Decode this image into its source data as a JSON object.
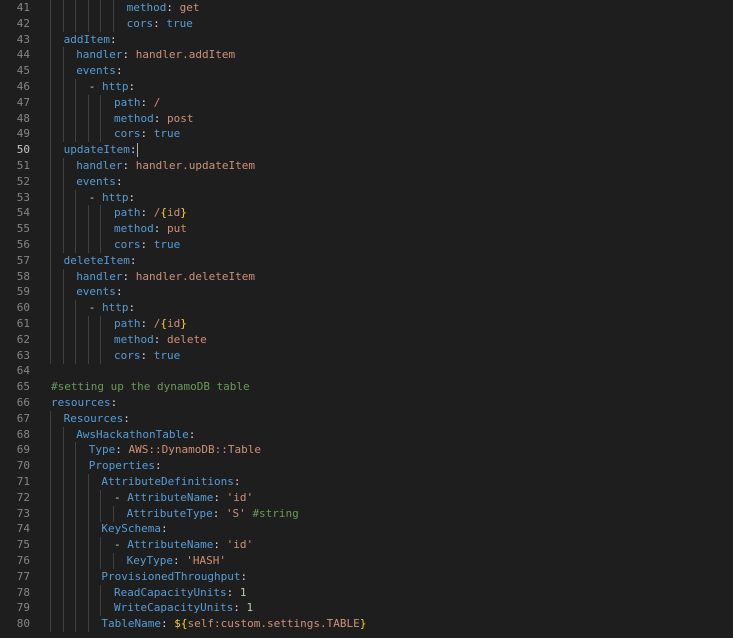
{
  "editor": {
    "active_line": 50,
    "lines": [
      {
        "no": "41",
        "indent": 6,
        "segs": [
          {
            "t": "method",
            "c": "k"
          },
          {
            "t": ": ",
            "c": "p"
          },
          {
            "t": "get",
            "c": "s"
          }
        ]
      },
      {
        "no": "42",
        "indent": 6,
        "segs": [
          {
            "t": "cors",
            "c": "k"
          },
          {
            "t": ": ",
            "c": "p"
          },
          {
            "t": "true",
            "c": "k"
          }
        ]
      },
      {
        "no": "43",
        "indent": 1,
        "segs": [
          {
            "t": "addItem",
            "c": "k"
          },
          {
            "t": ":",
            "c": "p"
          }
        ]
      },
      {
        "no": "44",
        "indent": 2,
        "segs": [
          {
            "t": "handler",
            "c": "k"
          },
          {
            "t": ": ",
            "c": "p"
          },
          {
            "t": "handler.addItem",
            "c": "s"
          }
        ]
      },
      {
        "no": "45",
        "indent": 2,
        "segs": [
          {
            "t": "events",
            "c": "k"
          },
          {
            "t": ":",
            "c": "p"
          }
        ]
      },
      {
        "no": "46",
        "indent": 3,
        "segs": [
          {
            "t": "- ",
            "c": "p"
          },
          {
            "t": "http",
            "c": "k"
          },
          {
            "t": ":",
            "c": "p"
          }
        ]
      },
      {
        "no": "47",
        "indent": 5,
        "segs": [
          {
            "t": "path",
            "c": "k"
          },
          {
            "t": ": ",
            "c": "p"
          },
          {
            "t": "/",
            "c": "s"
          }
        ]
      },
      {
        "no": "48",
        "indent": 5,
        "segs": [
          {
            "t": "method",
            "c": "k"
          },
          {
            "t": ": ",
            "c": "p"
          },
          {
            "t": "post",
            "c": "s"
          }
        ]
      },
      {
        "no": "49",
        "indent": 5,
        "segs": [
          {
            "t": "cors",
            "c": "k"
          },
          {
            "t": ": ",
            "c": "p"
          },
          {
            "t": "true",
            "c": "k"
          }
        ]
      },
      {
        "no": "50",
        "indent": 1,
        "segs": [
          {
            "t": "updateItem",
            "c": "k"
          },
          {
            "t": ":",
            "c": "p"
          }
        ]
      },
      {
        "no": "51",
        "indent": 2,
        "segs": [
          {
            "t": "handler",
            "c": "k"
          },
          {
            "t": ": ",
            "c": "p"
          },
          {
            "t": "handler.updateItem",
            "c": "s"
          }
        ]
      },
      {
        "no": "52",
        "indent": 2,
        "segs": [
          {
            "t": "events",
            "c": "k"
          },
          {
            "t": ":",
            "c": "p"
          }
        ]
      },
      {
        "no": "53",
        "indent": 3,
        "segs": [
          {
            "t": "- ",
            "c": "p"
          },
          {
            "t": "http",
            "c": "k"
          },
          {
            "t": ":",
            "c": "p"
          }
        ]
      },
      {
        "no": "54",
        "indent": 5,
        "segs": [
          {
            "t": "path",
            "c": "k"
          },
          {
            "t": ": ",
            "c": "p"
          },
          {
            "t": "/",
            "c": "s"
          },
          {
            "t": "{",
            "c": "b"
          },
          {
            "t": "id",
            "c": "s"
          },
          {
            "t": "}",
            "c": "b"
          }
        ]
      },
      {
        "no": "55",
        "indent": 5,
        "segs": [
          {
            "t": "method",
            "c": "k"
          },
          {
            "t": ": ",
            "c": "p"
          },
          {
            "t": "put",
            "c": "s"
          }
        ]
      },
      {
        "no": "56",
        "indent": 5,
        "segs": [
          {
            "t": "cors",
            "c": "k"
          },
          {
            "t": ": ",
            "c": "p"
          },
          {
            "t": "true",
            "c": "k"
          }
        ]
      },
      {
        "no": "57",
        "indent": 1,
        "segs": [
          {
            "t": "deleteItem",
            "c": "k"
          },
          {
            "t": ":",
            "c": "p"
          }
        ]
      },
      {
        "no": "58",
        "indent": 2,
        "segs": [
          {
            "t": "handler",
            "c": "k"
          },
          {
            "t": ": ",
            "c": "p"
          },
          {
            "t": "handler.deleteItem",
            "c": "s"
          }
        ]
      },
      {
        "no": "59",
        "indent": 2,
        "segs": [
          {
            "t": "events",
            "c": "k"
          },
          {
            "t": ":",
            "c": "p"
          }
        ]
      },
      {
        "no": "60",
        "indent": 3,
        "segs": [
          {
            "t": "- ",
            "c": "p"
          },
          {
            "t": "http",
            "c": "k"
          },
          {
            "t": ":",
            "c": "p"
          }
        ]
      },
      {
        "no": "61",
        "indent": 5,
        "segs": [
          {
            "t": "path",
            "c": "k"
          },
          {
            "t": ": ",
            "c": "p"
          },
          {
            "t": "/",
            "c": "s"
          },
          {
            "t": "{",
            "c": "b"
          },
          {
            "t": "id",
            "c": "s"
          },
          {
            "t": "}",
            "c": "b"
          }
        ]
      },
      {
        "no": "62",
        "indent": 5,
        "segs": [
          {
            "t": "method",
            "c": "k"
          },
          {
            "t": ": ",
            "c": "p"
          },
          {
            "t": "delete",
            "c": "s"
          }
        ]
      },
      {
        "no": "63",
        "indent": 5,
        "segs": [
          {
            "t": "cors",
            "c": "k"
          },
          {
            "t": ": ",
            "c": "p"
          },
          {
            "t": "true",
            "c": "k"
          }
        ]
      },
      {
        "no": "64",
        "indent": 0,
        "segs": []
      },
      {
        "no": "65",
        "indent": 0,
        "segs": [
          {
            "t": "#setting up the dynamoDB table",
            "c": "c"
          }
        ]
      },
      {
        "no": "66",
        "indent": 0,
        "segs": [
          {
            "t": "resources",
            "c": "k"
          },
          {
            "t": ":",
            "c": "p"
          }
        ]
      },
      {
        "no": "67",
        "indent": 1,
        "segs": [
          {
            "t": "Resources",
            "c": "k"
          },
          {
            "t": ":",
            "c": "p"
          }
        ]
      },
      {
        "no": "68",
        "indent": 2,
        "segs": [
          {
            "t": "AwsHackathonTable",
            "c": "k"
          },
          {
            "t": ":",
            "c": "p"
          }
        ]
      },
      {
        "no": "69",
        "indent": 3,
        "segs": [
          {
            "t": "Type",
            "c": "k"
          },
          {
            "t": ": ",
            "c": "p"
          },
          {
            "t": "AWS::DynamoDB::Table",
            "c": "s"
          }
        ]
      },
      {
        "no": "70",
        "indent": 3,
        "segs": [
          {
            "t": "Properties",
            "c": "k"
          },
          {
            "t": ":",
            "c": "p"
          }
        ]
      },
      {
        "no": "71",
        "indent": 4,
        "segs": [
          {
            "t": "AttributeDefinitions",
            "c": "k"
          },
          {
            "t": ":",
            "c": "p"
          }
        ]
      },
      {
        "no": "72",
        "indent": 5,
        "segs": [
          {
            "t": "- ",
            "c": "p"
          },
          {
            "t": "AttributeName",
            "c": "k"
          },
          {
            "t": ": ",
            "c": "p"
          },
          {
            "t": "'id'",
            "c": "s"
          }
        ]
      },
      {
        "no": "73",
        "indent": 6,
        "segs": [
          {
            "t": "AttributeType",
            "c": "k"
          },
          {
            "t": ": ",
            "c": "p"
          },
          {
            "t": "'S'",
            "c": "s"
          },
          {
            "t": " ",
            "c": "p"
          },
          {
            "t": "#string",
            "c": "c"
          }
        ]
      },
      {
        "no": "74",
        "indent": 4,
        "segs": [
          {
            "t": "KeySchema",
            "c": "k"
          },
          {
            "t": ":",
            "c": "p"
          }
        ]
      },
      {
        "no": "75",
        "indent": 5,
        "segs": [
          {
            "t": "- ",
            "c": "p"
          },
          {
            "t": "AttributeName",
            "c": "k"
          },
          {
            "t": ": ",
            "c": "p"
          },
          {
            "t": "'id'",
            "c": "s"
          }
        ]
      },
      {
        "no": "76",
        "indent": 6,
        "segs": [
          {
            "t": "KeyType",
            "c": "k"
          },
          {
            "t": ": ",
            "c": "p"
          },
          {
            "t": "'HASH'",
            "c": "s"
          }
        ]
      },
      {
        "no": "77",
        "indent": 4,
        "segs": [
          {
            "t": "ProvisionedThroughput",
            "c": "k"
          },
          {
            "t": ":",
            "c": "p"
          }
        ]
      },
      {
        "no": "78",
        "indent": 5,
        "segs": [
          {
            "t": "ReadCapacityUnits",
            "c": "k"
          },
          {
            "t": ": ",
            "c": "p"
          },
          {
            "t": "1",
            "c": "n"
          }
        ]
      },
      {
        "no": "79",
        "indent": 5,
        "segs": [
          {
            "t": "WriteCapacityUnits",
            "c": "k"
          },
          {
            "t": ": ",
            "c": "p"
          },
          {
            "t": "1",
            "c": "n"
          }
        ]
      },
      {
        "no": "80",
        "indent": 4,
        "segs": [
          {
            "t": "TableName",
            "c": "k"
          },
          {
            "t": ": ",
            "c": "p"
          },
          {
            "t": "${",
            "c": "b"
          },
          {
            "t": "self:custom.settings.TABLE",
            "c": "s"
          },
          {
            "t": "}",
            "c": "b"
          }
        ]
      }
    ]
  }
}
